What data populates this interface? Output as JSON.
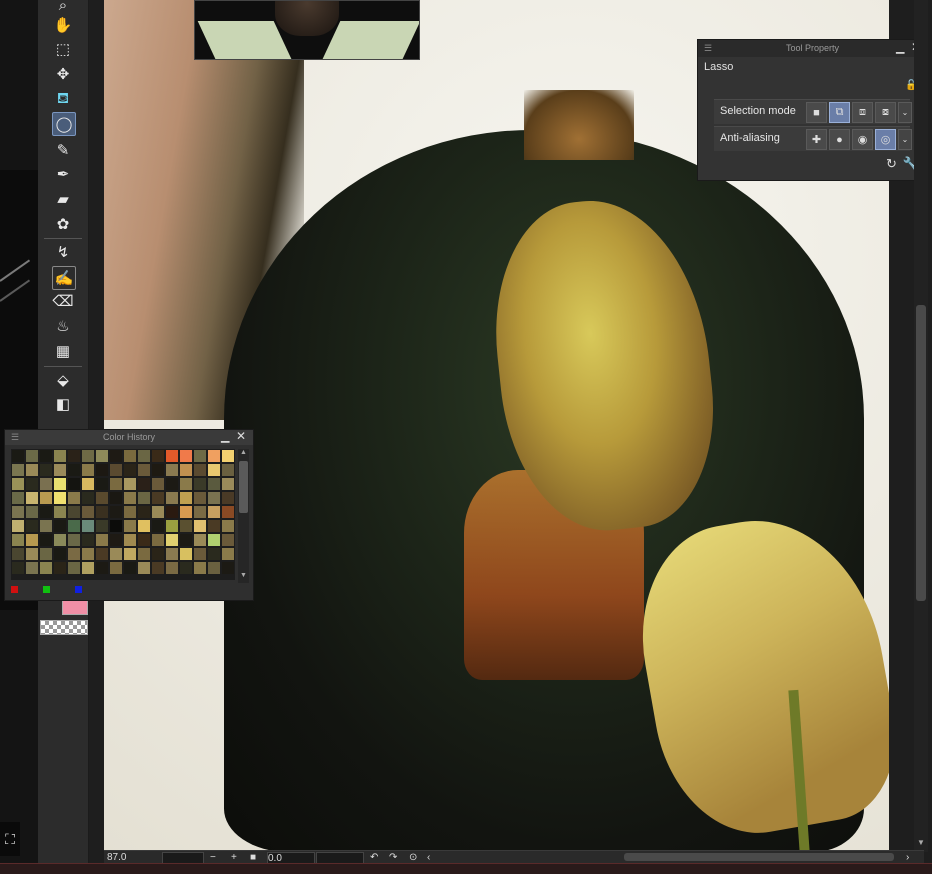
{
  "tool_property": {
    "title": "Tool Property",
    "tool_name": "Lasso",
    "rows": [
      {
        "label": "Selection mode"
      },
      {
        "label": "Anti-aliasing"
      }
    ]
  },
  "color_history": {
    "title": "Color History",
    "colors": [
      "#1a1a14",
      "#6b6a48",
      "#1a1a14",
      "#8a8450",
      "#2a2218",
      "#6e6a46",
      "#8e8a5a",
      "#1e1a14",
      "#7a6a3e",
      "#6a6644",
      "#3a2a18",
      "#e35a2a",
      "#f07a4a",
      "#6e6a46",
      "#f0a060",
      "#f2d070",
      "#7a7650",
      "#9a8a58",
      "#2a2a1e",
      "#9a8a5a",
      "#1a1a14",
      "#8a7a4a",
      "#1c1812",
      "#5a4a30",
      "#2a2418",
      "#6a5a3a",
      "#1e1a12",
      "#8a7a50",
      "#c09050",
      "#5a4a30",
      "#e8c870",
      "#6a6040",
      "#9a9258",
      "#2a2a1e",
      "#7a7050",
      "#e8e070",
      "#141410",
      "#d8b860",
      "#1a1a14",
      "#7a6a40",
      "#a89860",
      "#2a2018",
      "#6a5a3a",
      "#1c1a14",
      "#8a7a4a",
      "#3a3a28",
      "#5a5a3e",
      "#9a8a5a",
      "#6a6a48",
      "#c8b470",
      "#b89a50",
      "#f0e070",
      "#8a7a4a",
      "#2a2a1e",
      "#5a4a2e",
      "#1a1812",
      "#8a7a4a",
      "#6a6644",
      "#4a3a24",
      "#8a7a50",
      "#c0a050",
      "#6a5a3a",
      "#7a7250",
      "#4a3a26",
      "#7a7450",
      "#6a6848",
      "#1a1a14",
      "#8a8450",
      "#4a4630",
      "#6a5a3a",
      "#3a3020",
      "#1c1a14",
      "#7a6a40",
      "#2a2418",
      "#9a8a58",
      "#2a1a10",
      "#d89a50",
      "#7a6a44",
      "#c8a060",
      "#8a4a24",
      "#c0b070",
      "#2a2a1e",
      "#7a7450",
      "#1a1a14",
      "#4a6a4a",
      "#6a8a7a",
      "#3a3a28",
      "#0c0c0a",
      "#8a7a4a",
      "#e0c060",
      "#1a1a14",
      "#9aa040",
      "#5a5030",
      "#e0c070",
      "#4a3a24",
      "#8a7a4a",
      "#8a8450",
      "#b89a50",
      "#1a1a14",
      "#8a8a5a",
      "#6a6848",
      "#2a2a1e",
      "#8a7a4a",
      "#1e1a14",
      "#a08a50",
      "#3a2a18",
      "#7a6a40",
      "#e0d070",
      "#1c1a14",
      "#9a8a58",
      "#b0d070",
      "#6a5a3a",
      "#4a4630",
      "#9a8a58",
      "#6a6644",
      "#1a1a14",
      "#7a6a44",
      "#8a7a4a",
      "#4a3a24",
      "#9a8a58",
      "#c0a860",
      "#7a6a40",
      "#2a2418",
      "#8a7a50",
      "#d8c060",
      "#6a5a3a",
      "#2a2a1e",
      "#8a7a4a",
      "#2a2a1e",
      "#7a7450",
      "#8a8450",
      "#2a2418",
      "#6a6644",
      "#b0a060",
      "#1c1a14",
      "#7a6a40",
      "#1a1a14",
      "#9a8a58",
      "#4a3a24",
      "#7a6a44",
      "#2a2a1e",
      "#8a7a4a",
      "#6a6040",
      "#1c1a14"
    ],
    "rgb_marks": [
      "#d01010",
      "#10c010",
      "#1020e0"
    ]
  },
  "status_bar": {
    "zoom": "87.0",
    "minus": "−",
    "plus": "+",
    "rotation": "0.0"
  },
  "toolbar": {
    "tools": [
      {
        "name": "zoom-tool-icon",
        "glyph": "🔍"
      },
      {
        "name": "hand-tool-icon",
        "glyph": "✋"
      },
      {
        "name": "object-tool-icon",
        "glyph": "⬚"
      },
      {
        "name": "move-layer-tool-icon",
        "glyph": "✥"
      },
      {
        "name": "auto-select-tool-icon",
        "glyph": "⛾"
      },
      {
        "name": "lasso-tool-icon",
        "glyph": "◯"
      },
      {
        "name": "eyedropper-tool-icon",
        "glyph": "✎"
      },
      {
        "name": "pen-tool-icon",
        "glyph": "✒"
      },
      {
        "name": "brush-tool-icon",
        "glyph": "🖌"
      },
      {
        "name": "decoration-tool-icon",
        "glyph": "✿"
      },
      {
        "name": "correct-line-tool-icon",
        "glyph": "↯"
      },
      {
        "name": "vector-pen-tool-icon",
        "glyph": "✍"
      },
      {
        "name": "eraser-tool-icon",
        "glyph": "⌫"
      },
      {
        "name": "blend-tool-icon",
        "glyph": "💧"
      },
      {
        "name": "frame-tool-icon",
        "glyph": "▦"
      },
      {
        "name": "fill-tool-icon",
        "glyph": "⬙"
      },
      {
        "name": "gradient-tool-icon",
        "glyph": "◧"
      }
    ]
  }
}
